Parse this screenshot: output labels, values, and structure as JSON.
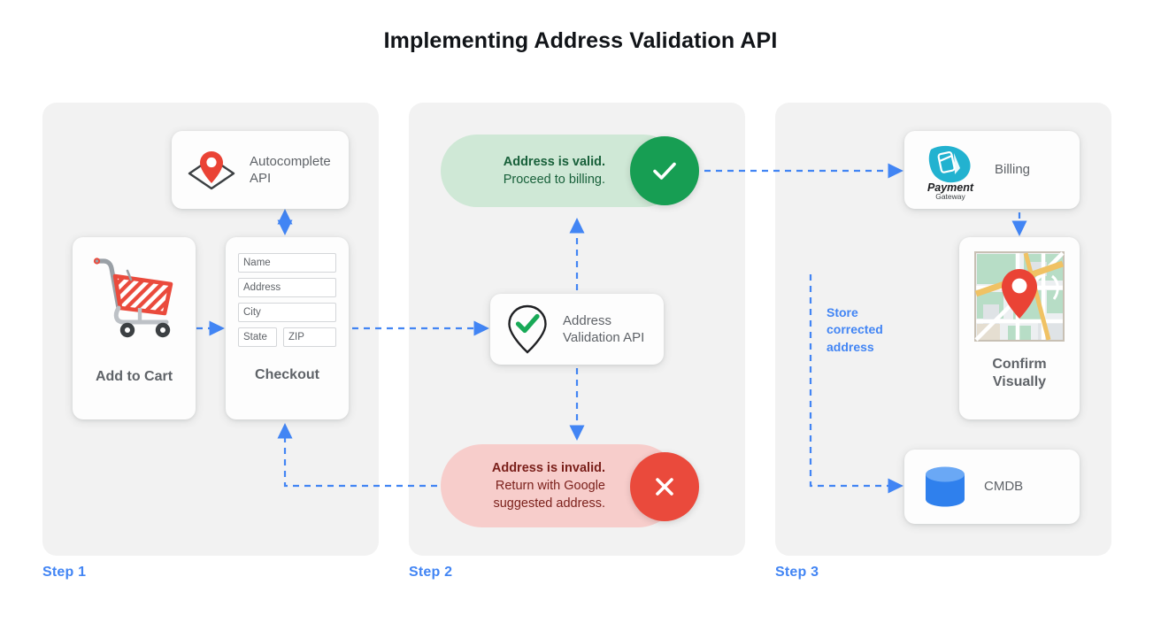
{
  "page": {
    "title": "Implementing Address Validation API"
  },
  "colors": {
    "accent_blue": "#4285f4",
    "valid_green": "#179e53",
    "valid_pill_bg": "#cfe8d6",
    "valid_text": "#18603a",
    "invalid_red": "#ea4a3c",
    "invalid_pill_bg": "#f7cdcb",
    "invalid_text": "#7a1f1a",
    "panel_bg": "#f2f2f2",
    "card_bg": "#fdfdfd",
    "label_gray": "#5f6368",
    "pin_red": "#ea4335",
    "db_blue": "#4285f4",
    "payment_teal": "#22b2d0"
  },
  "steps": [
    {
      "label": "Step 1"
    },
    {
      "label": "Step 2"
    },
    {
      "label": "Step 3"
    }
  ],
  "step1": {
    "autocomplete_card": {
      "label": "Autocomplete\nAPI",
      "icon": "map-pin-diamond-icon"
    },
    "add_to_cart_card": {
      "label": "Add to Cart",
      "icon": "shopping-cart-icon"
    },
    "checkout_card": {
      "label": "Checkout",
      "fields": [
        {
          "name": "name",
          "placeholder": "Name"
        },
        {
          "name": "address",
          "placeholder": "Address"
        },
        {
          "name": "city",
          "placeholder": "City"
        },
        {
          "name": "state",
          "placeholder": "State"
        },
        {
          "name": "zip",
          "placeholder": "ZIP"
        }
      ]
    }
  },
  "step2": {
    "validation_card": {
      "label": "Address\nValidation API",
      "icon": "map-pin-check-icon"
    },
    "valid_result": {
      "line1": "Address is valid.",
      "line2": "Proceed to billing.",
      "icon": "check-icon"
    },
    "invalid_result": {
      "line1": "Address is invalid.",
      "line2": "Return with Google",
      "line3": "suggested address.",
      "icon": "close-icon"
    }
  },
  "step3": {
    "billing_card": {
      "label": "Billing",
      "logo_primary": "Payment",
      "logo_secondary": "Gateway",
      "icon": "payment-gateway-logo-icon"
    },
    "confirm_card": {
      "label": "Confirm\nVisually",
      "icon": "map-thumbnail-icon"
    },
    "cmdb_card": {
      "label": "CMDB",
      "icon": "database-icon"
    },
    "store_note": "Store\ncorrected\naddress"
  }
}
